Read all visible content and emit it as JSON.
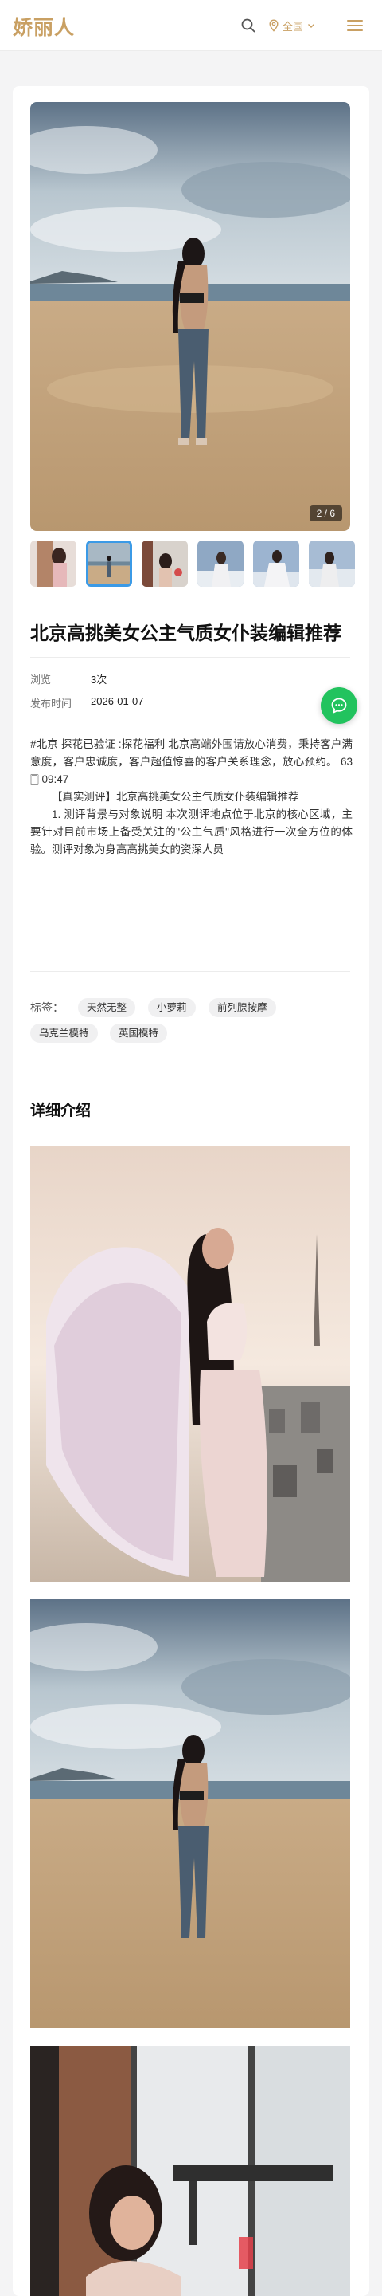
{
  "header": {
    "logo": "娇丽人",
    "region_label": "全国"
  },
  "gallery": {
    "counter": "2 / 6",
    "thumbnail_count": 6,
    "active_index": 1
  },
  "article": {
    "title": "北京高挑美女公主气质女仆装编辑推荐",
    "meta": [
      {
        "label": "浏览",
        "value": "3次"
      },
      {
        "label": "发布时间",
        "value": "2026-01-07"
      }
    ],
    "desc_p1": "#北京  探花已验证          :探花福利          北京高端外围请放心消费，秉持客户满意度，客户忠诚度，客户超值惊喜的客户关系理念，放心预约。       63         🀆         09:47",
    "desc_p2": "【真实测评】北京高挑美女公主气质女仆装编辑推荐",
    "desc_p3": "1. 测评背景与对象说明          本次测评地点位于北京的核心区域，主要针对目前市场上备受关注的\"公主气质\"风格进行一次全方位的体验。测评对象为身高高挑美女的资深人员"
  },
  "tags": {
    "label": "标签：",
    "items": [
      "天然无整",
      "小萝莉",
      "前列腺按摩",
      "乌克兰模特",
      "英国模特"
    ]
  },
  "detail": {
    "section_title": "详细介绍"
  },
  "colors": {
    "brand_gold": "#c9a063",
    "chat_green": "#22c35e",
    "thumb_active": "#3b9ae6"
  }
}
